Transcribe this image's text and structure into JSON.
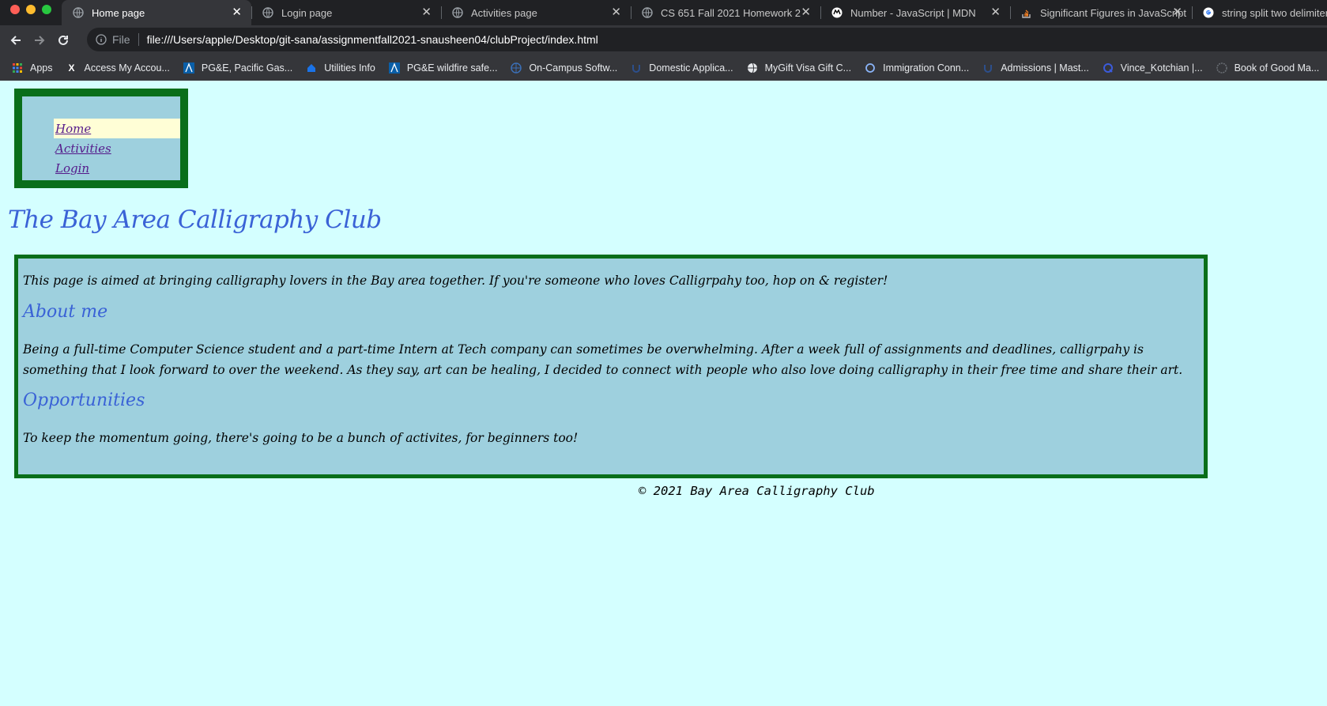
{
  "browser": {
    "tabs": [
      {
        "label": "Home page",
        "icon": "globe-icon",
        "active": true
      },
      {
        "label": "Login page",
        "icon": "globe-icon",
        "active": false
      },
      {
        "label": "Activities page",
        "icon": "globe-icon",
        "active": false
      },
      {
        "label": "CS 651 Fall 2021 Homework 2",
        "icon": "globe-icon",
        "active": false
      },
      {
        "label": "Number - JavaScript | MDN",
        "icon": "mdn-icon",
        "active": false
      },
      {
        "label": "Significant Figures in JavaScript",
        "icon": "stackoverflow-icon",
        "active": false
      },
      {
        "label": "string split two delimiters",
        "icon": "google-icon",
        "active": false
      }
    ],
    "address": {
      "scheme": "File",
      "url": "file:///Users/apple/Desktop/git-sana/assignmentfall2021-snausheen04/clubProject/index.html"
    },
    "bookmarks": [
      {
        "label": "Apps",
        "icon": "apps-grid-icon"
      },
      {
        "label": "Access My Accou...",
        "icon": "x-icon"
      },
      {
        "label": "PG&E, Pacific Gas...",
        "icon": "pge-icon"
      },
      {
        "label": "Utilities Info",
        "icon": "house-icon"
      },
      {
        "label": "PG&E wildfire safe...",
        "icon": "pge-icon"
      },
      {
        "label": "On-Campus Softw...",
        "icon": "compass-icon"
      },
      {
        "label": "Domestic Applica...",
        "icon": "uc-icon"
      },
      {
        "label": "MyGift Visa Gift C...",
        "icon": "globe-icon"
      },
      {
        "label": "Immigration Conn...",
        "icon": "circle-icon"
      },
      {
        "label": "Admissions | Mast...",
        "icon": "uc-icon"
      },
      {
        "label": "Vince_Kotchian |...",
        "icon": "q-icon"
      },
      {
        "label": "Book of Good Ma...",
        "icon": "book-icon"
      }
    ]
  },
  "nav": {
    "items": [
      {
        "label": "Home",
        "current": true
      },
      {
        "label": "Activities",
        "current": false
      },
      {
        "label": "Login",
        "current": false
      }
    ]
  },
  "site_title": "The Bay Area Calligraphy Club",
  "main": {
    "intro": "This page is aimed at bringing calligraphy lovers in the Bay area together. If you're someone who loves Calligrpahy too, hop on & register!",
    "about_heading": "About me",
    "about_text": "Being a full-time Computer Science student and a part-time Intern at Tech company can sometimes be overwhelming. After a week full of assignments and deadlines, calligrpahy is something that I look forward to over the weekend. As they say, art can be healing, I decided to connect with people who also love doing calligraphy in their free time and share their art.",
    "opportunities_heading": "Opportunities",
    "opportunities_text": "To keep the momentum going, there's going to be a bunch of activites, for beginners too!"
  },
  "footer": "© 2021 Bay Area Calligraphy Club",
  "colors": {
    "page_bg": "#d4ffff",
    "panel_bg": "#9ed0de",
    "panel_border": "#0a6e1a",
    "heading": "#3a62d6",
    "link": "#551a8b",
    "nav_highlight": "#fffed6"
  }
}
